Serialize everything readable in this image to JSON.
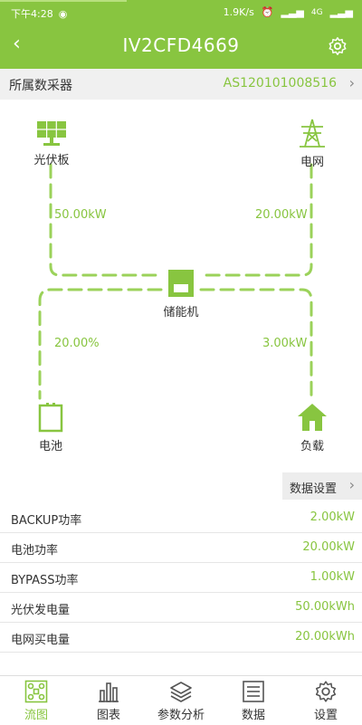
{
  "status": {
    "time": "下午4:28",
    "speed": "1.9K/s",
    "signal": "4G"
  },
  "header": {
    "title": "IV2CFD4669",
    "back_icon": "‹"
  },
  "collector": {
    "label": "所属数采器",
    "value": "AS120101008516"
  },
  "diagram": {
    "pv_label": "光伏板",
    "grid_label": "电网",
    "storage_label": "储能机",
    "battery_label": "电池",
    "load_label": "负载",
    "pv_power": "50.00kW",
    "grid_power": "20.00kW",
    "battery_percent": "20.00%",
    "load_power": "3.00kW"
  },
  "data_settings_label": "数据设置",
  "metrics": [
    {
      "label": "BACKUP功率",
      "value": "2.00kW"
    },
    {
      "label": "电池功率",
      "value": "20.00kW"
    },
    {
      "label": "BYPASS功率",
      "value": "1.00kW"
    },
    {
      "label": "光伏发电量",
      "value": "50.00kWh"
    },
    {
      "label": "电网买电量",
      "value": "20.00kWh"
    }
  ],
  "tabs": [
    {
      "label": "流图"
    },
    {
      "label": "图表"
    },
    {
      "label": "参数分析"
    },
    {
      "label": "数据"
    },
    {
      "label": "设置"
    }
  ],
  "colors": {
    "accent": "#88c540",
    "text": "#333333"
  }
}
